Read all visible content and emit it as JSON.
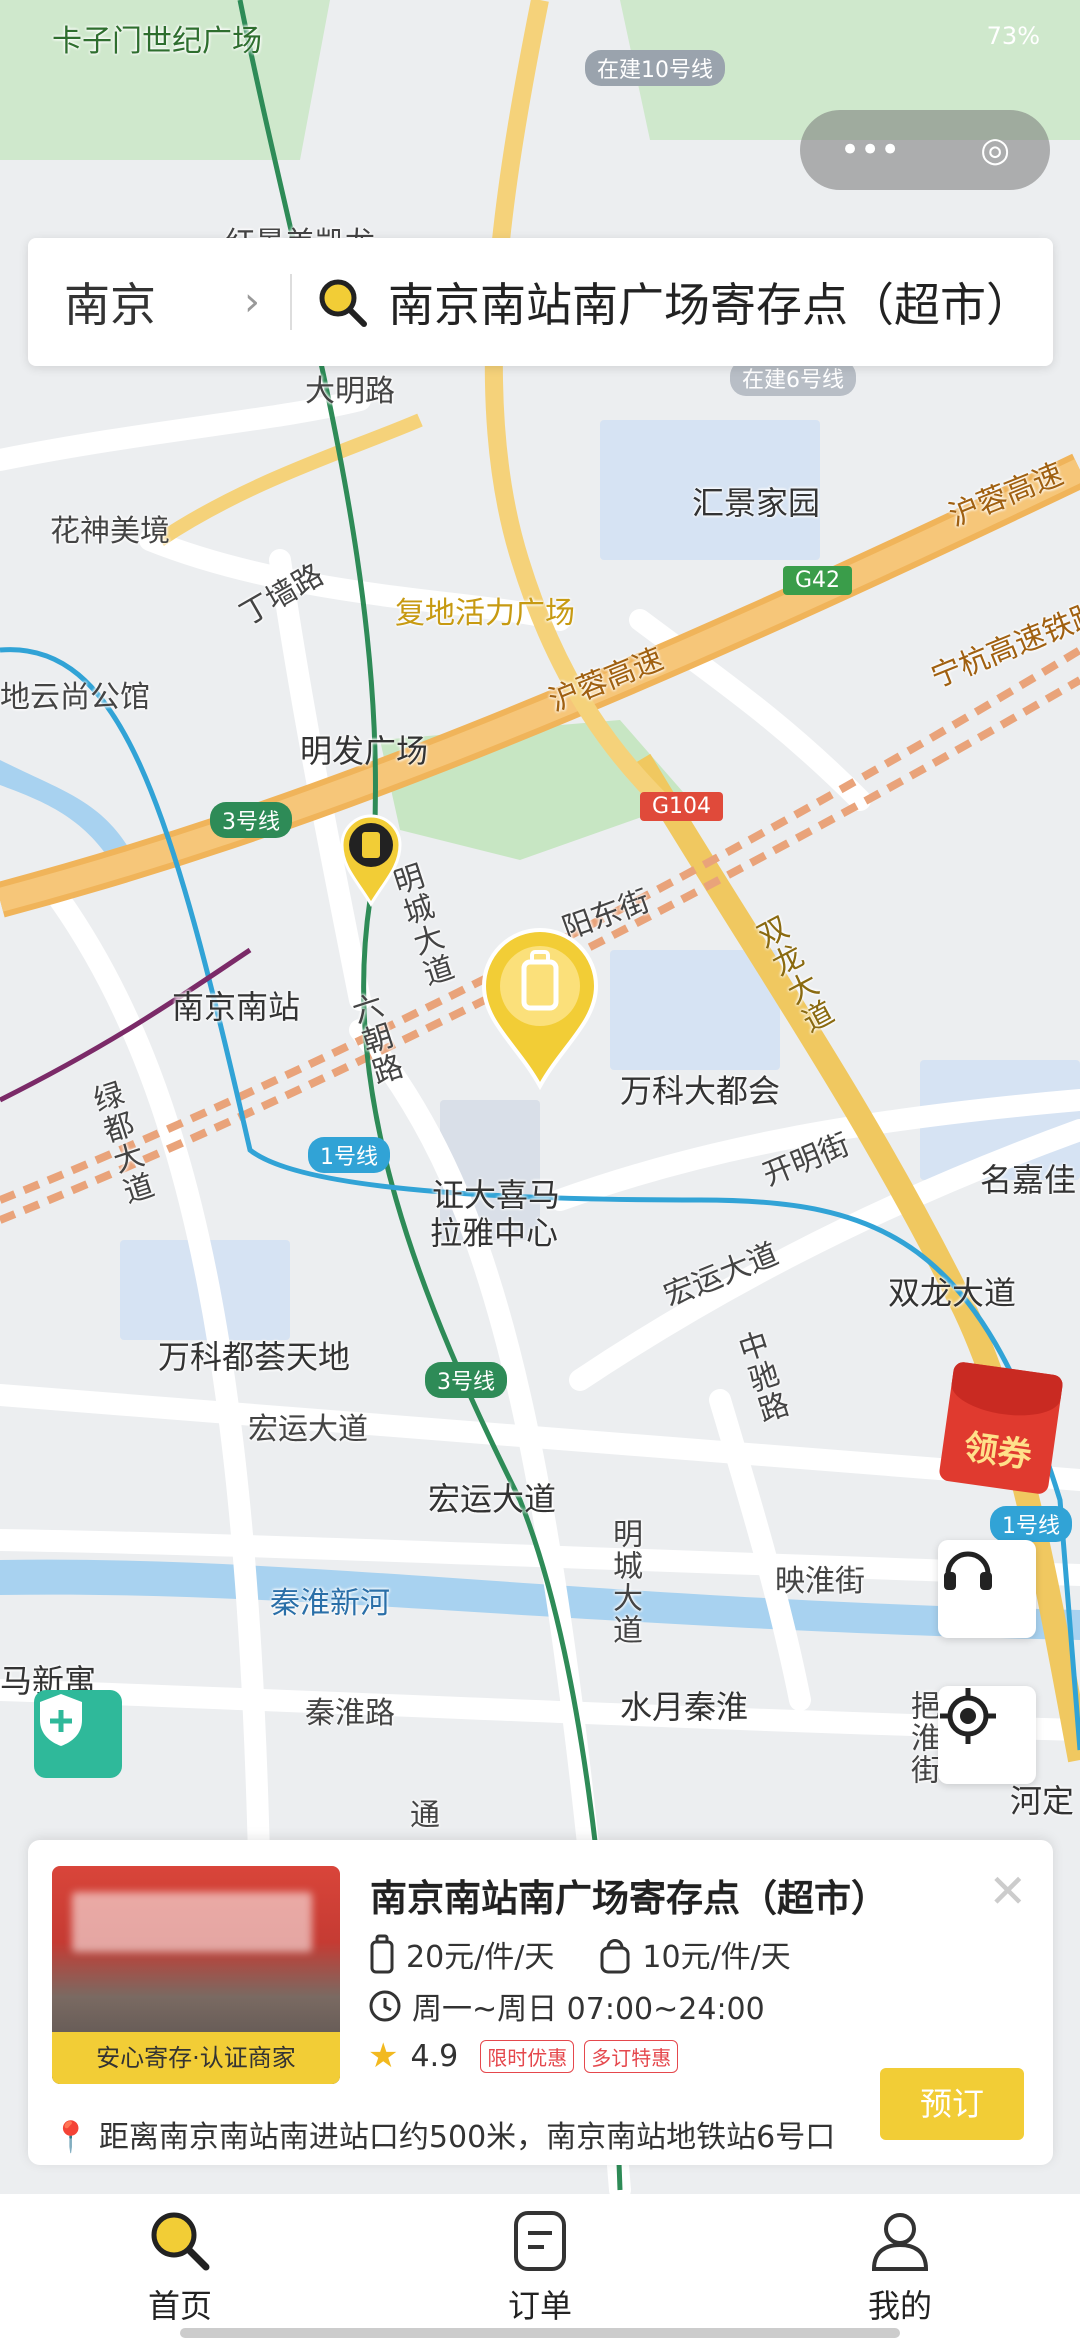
{
  "status_bar": {
    "battery": "73%"
  },
  "top_left_label": "卡子门世纪广场",
  "search": {
    "city": "南京",
    "query": "南京南站南广场寄存点（超市）"
  },
  "map_labels": {
    "line10": "在建10号线",
    "hongjing": "红景美凯龙",
    "daming": "大明路",
    "line6": "在建6号线",
    "huijing": "汇景家园",
    "hushen": "沪蓉高速",
    "huashen": "花神美境",
    "dingqiang": "丁墙路",
    "fudi": "复地活力广场",
    "g42": "G42",
    "ninghang": "宁杭高速铁路",
    "yunshang": "地云尚公馆",
    "mingfa": "明发广场",
    "hurong2": "沪蓉高速",
    "line3": "3号线",
    "g104": "G104",
    "mingcheng": "明城大道",
    "yangdong": "阳东街",
    "shuanglong": "双龙大道",
    "nanjingnan": "南京南站",
    "liuchao": "六朝路",
    "wanke": "万科大都会",
    "lvdu": "绿都大道",
    "line1": "1号线",
    "zhengda1": "证大喜马",
    "zhengda2": "拉雅中心",
    "kaiming": "开明街",
    "mingjia": "名嘉佳",
    "hongyun": "宏运大道",
    "shuanglong2": "双龙大道",
    "zhongchi": "中驰路",
    "wankedu": "万科都荟天地",
    "line3b": "3号线",
    "hongyun2": "宏运大道",
    "hongyun3": "宏运大道",
    "mingcheng2": "明城大道",
    "yinghuai": "映淮街",
    "line1b": "1号线",
    "qinhuaixinhe": "秦淮新河",
    "maxinyu": "马新寓",
    "qinhuai": "秦淮路",
    "shuiyue": "水月秦淮",
    "yihuai": "挹淮街",
    "heding": "河定",
    "tong": "通",
    "coupon": "领券"
  },
  "store_card": {
    "title": "南京南站南广场寄存点（超市）",
    "price_luggage": "20元/件/天",
    "price_bag": "10元/件/天",
    "hours": "周一~周日 07:00~24:00",
    "rating": "4.9",
    "tags": [
      "限时优惠",
      "多订特惠"
    ],
    "photo_tag": "安心寄存·认证商家",
    "address": "距离南京南站南进站口约500米，南京南站地铁站6号口",
    "book_label": "预订"
  },
  "tabs": [
    {
      "label": "首页",
      "icon": "search-icon"
    },
    {
      "label": "订单",
      "icon": "order-icon"
    },
    {
      "label": "我的",
      "icon": "person-icon"
    }
  ]
}
